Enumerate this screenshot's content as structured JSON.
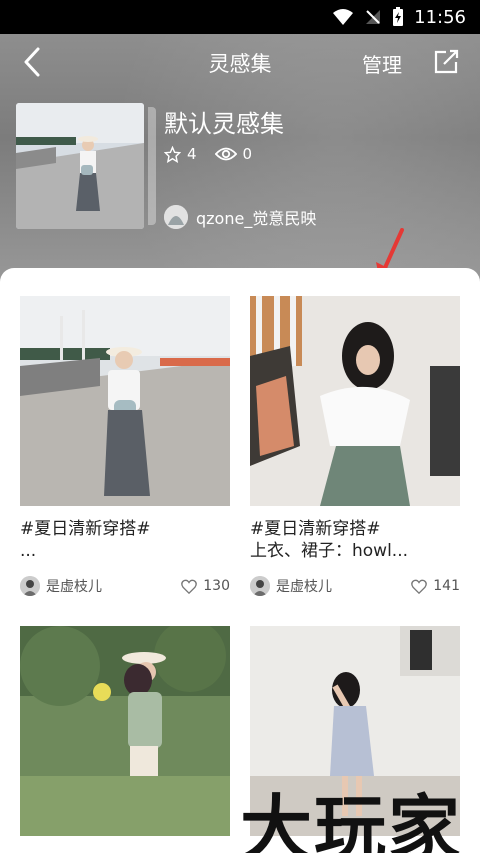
{
  "status": {
    "time": "11:56"
  },
  "nav": {
    "title": "灵感集",
    "manage": "管理"
  },
  "collection": {
    "title": "默认灵感集",
    "stars": "4",
    "views": "0",
    "owner": "qzone_觉意民映"
  },
  "cards": [
    {
      "title": "#夏日清新穿搭#",
      "subtitle": "...",
      "user": "是虚枝儿",
      "likes": "130"
    },
    {
      "title": "#夏日清新穿搭#",
      "subtitle": "上衣、裙子：howl...",
      "user": "是虚枝儿",
      "likes": "141"
    }
  ],
  "watermark": "大玩家",
  "colors": {
    "arrow": "#e53935",
    "header_bg": "#8a8a8a"
  }
}
